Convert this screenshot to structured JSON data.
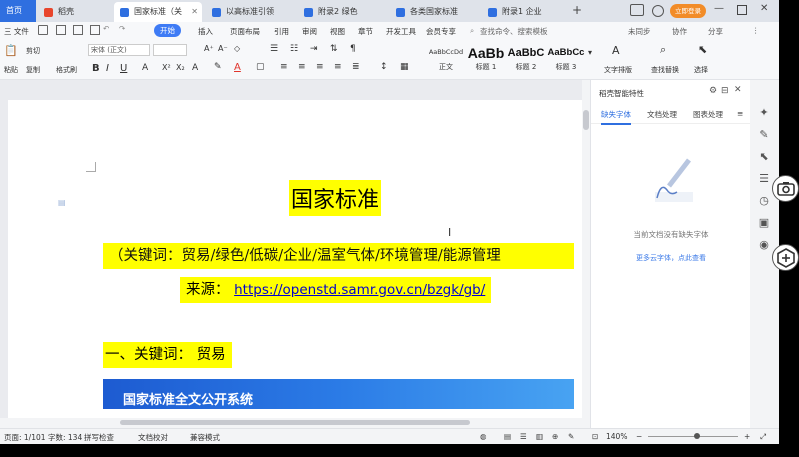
{
  "tabs": [
    {
      "label": "首页",
      "kind": "home"
    },
    {
      "label": "稻壳",
      "icon_color": "#e8452c"
    },
    {
      "label": "国家标准（关",
      "icon_color": "#2f6fe0",
      "active": true
    },
    {
      "label": "以高标准引领",
      "icon_color": "#2f6fe0"
    },
    {
      "label": "附录2  绿色",
      "icon_color": "#2f6fe0"
    },
    {
      "label": "各类国家标准",
      "icon_color": "#2f6fe0"
    },
    {
      "label": "附录1  企业",
      "icon_color": "#2f6fe0"
    }
  ],
  "tab_add": "+",
  "account_label": "立即登录",
  "menubar": {
    "file": "三 文件",
    "items": [
      "开始",
      "插入",
      "页面布局",
      "引用",
      "审阅",
      "视图",
      "章节",
      "开发工具",
      "会员专享"
    ],
    "active": "开始",
    "search_placeholder": "查找命令、搜索模板",
    "right": [
      "未同步",
      "协作",
      "分享"
    ]
  },
  "ribbon": {
    "paste": "粘贴",
    "cut": "剪切",
    "copy": "复制",
    "format_painter": "格式刷",
    "font_name": "宋体 (正文)",
    "font_size": "",
    "styles": [
      {
        "preview": "AaBbCcDd",
        "label": "正文"
      },
      {
        "preview": "AaBb",
        "label": "标题 1"
      },
      {
        "preview": "AaBbC",
        "label": "标题 2"
      },
      {
        "preview": "AaBbCc",
        "label": "标题 3"
      }
    ],
    "right_tools": [
      "文字排版",
      "查找替换",
      "选择"
    ]
  },
  "document": {
    "title": "国家标准",
    "keywords_line": "（关键词：贸易/绿色/低碳/企业/温室气体/环境管理/能源管理",
    "source_label": "来源：",
    "source_url": "https://openstd.samr.gov.cn/bzgk/gb/",
    "section_heading": "一、关键词：  贸易",
    "banner_text": "国家标准全文公开系统"
  },
  "panel": {
    "title": "稻壳智能特性",
    "tabs": [
      "缺失字体",
      "文档处理",
      "图表处理"
    ],
    "active_tab": "缺失字体",
    "empty_text": "当前文档没有缺失字体",
    "empty_link": "更多云字体，点此查看"
  },
  "status": {
    "page": "页面: 1/101",
    "words": "字数: 134",
    "spell": "拼写检查",
    "doc_check": "文档校对",
    "compat": "兼容模式",
    "zoom": "140%"
  },
  "colors": {
    "accent": "#2f6fe0",
    "highlight": "#ffff00",
    "link": "#0000d0"
  }
}
